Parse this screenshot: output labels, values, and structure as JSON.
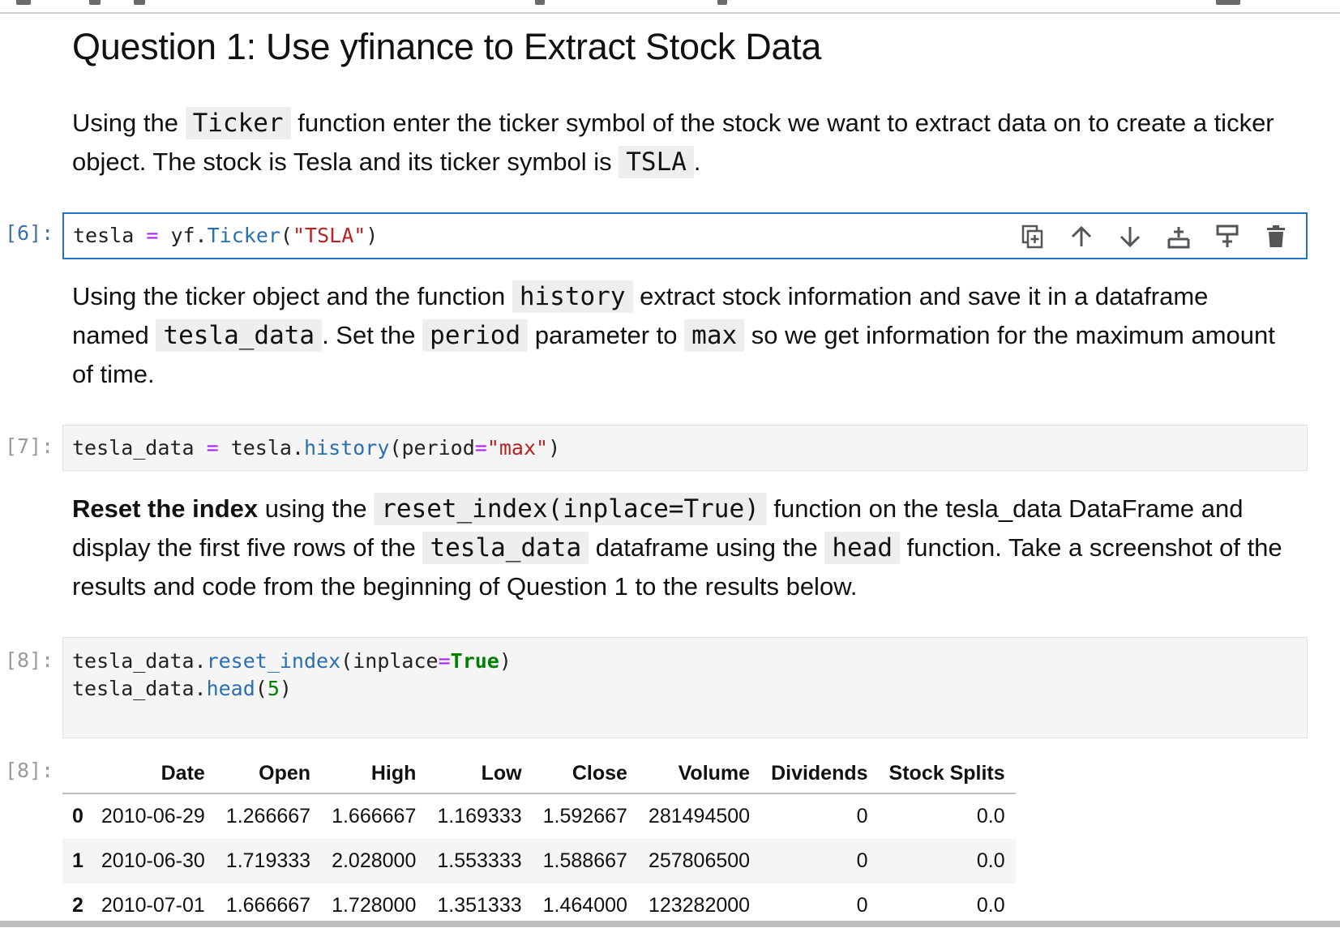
{
  "heading": "Question 1: Use yfinance to Extract Stock Data",
  "md1": {
    "t1": "Using the",
    "c1": "Ticker",
    "t2": "function enter the ticker symbol of the stock we want to extract data on to create a ticker object. The stock is Tesla and its ticker symbol is",
    "c2": "TSLA",
    "t3": "."
  },
  "cell6": {
    "prompt": "[6]:",
    "var": "tesla",
    "op": "=",
    "obj": "yf.",
    "fn": "Ticker",
    "open": "(",
    "arg": "\"TSLA\"",
    "close": ")"
  },
  "toolbar": {
    "icons": [
      "duplicate-icon",
      "move-up-icon",
      "move-down-icon",
      "insert-below-icon",
      "insert-above-icon",
      "delete-icon"
    ]
  },
  "md2": {
    "t1": "Using the ticker object and the function",
    "c1": "history",
    "t2": "extract stock information and save it in a dataframe named",
    "c2": "tesla_data",
    "t3": ". Set the",
    "c3": "period",
    "t4": "parameter to",
    "c4": "max",
    "t5": "so we get information for the maximum amount of time."
  },
  "cell7": {
    "prompt": "[7]:",
    "var": "tesla_data",
    "op": "=",
    "obj": "tesla.",
    "fn": "history",
    "open": "(",
    "param": "period",
    "eq": "=",
    "arg": "\"max\"",
    "close": ")"
  },
  "md3": {
    "b1": "Reset the index",
    "t1": "using the",
    "c1": "reset_index(inplace=True)",
    "t2": "function on the tesla_data DataFrame and display the first five rows of the",
    "c2": "tesla_data",
    "t3": "dataframe using the",
    "c3": "head",
    "t4": "function. Take a screenshot of the results and code from the beginning of Question 1 to the results below."
  },
  "cell8": {
    "prompt": "[8]:",
    "l1_obj": "tesla_data.",
    "l1_fn": "reset_index",
    "l1_open": "(",
    "l1_param": "inplace",
    "l1_eq": "=",
    "l1_val": "True",
    "l1_close": ")",
    "l2_obj": "tesla_data.",
    "l2_fn": "head",
    "l2_open": "(",
    "l2_val": "5",
    "l2_close": ")"
  },
  "output8": {
    "prompt": "[8]:",
    "columns": [
      "",
      "Date",
      "Open",
      "High",
      "Low",
      "Close",
      "Volume",
      "Dividends",
      "Stock Splits"
    ],
    "rows": [
      [
        "0",
        "2010-06-29",
        "1.266667",
        "1.666667",
        "1.169333",
        "1.592667",
        "281494500",
        "0",
        "0.0"
      ],
      [
        "1",
        "2010-06-30",
        "1.719333",
        "2.028000",
        "1.553333",
        "1.588667",
        "257806500",
        "0",
        "0.0"
      ],
      [
        "2",
        "2010-07-01",
        "1.666667",
        "1.728000",
        "1.351333",
        "1.464000",
        "123282000",
        "0",
        "0.0"
      ]
    ]
  }
}
